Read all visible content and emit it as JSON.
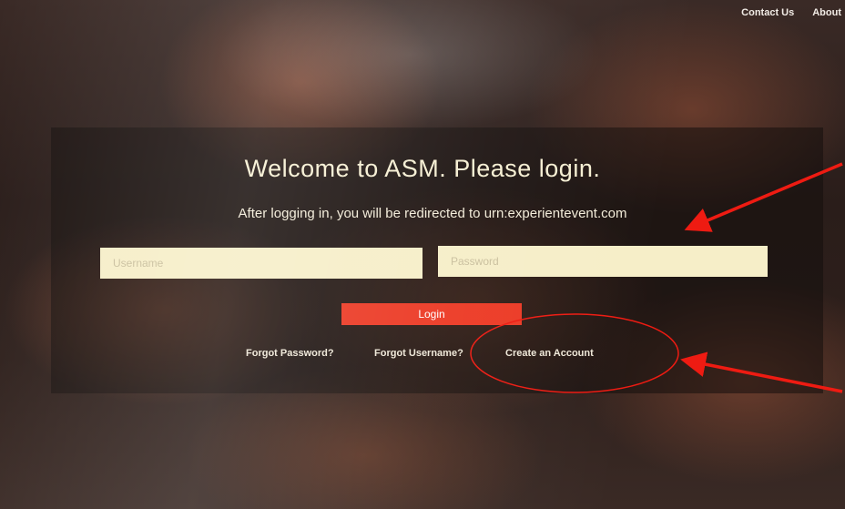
{
  "nav": {
    "contact_label": "Contact Us",
    "about_label": "About"
  },
  "login": {
    "title": "Welcome to ASM. Please login.",
    "redirect_text": "After logging in, you will be redirected to urn:experientevent.com",
    "username_placeholder": "Username",
    "password_placeholder": "Password",
    "login_label": "Login",
    "forgot_password_label": "Forgot Password?",
    "forgot_username_label": "Forgot Username?",
    "create_account_label": "Create an Account"
  },
  "colors": {
    "login_button": "#ec3a25",
    "field_background": "#f6eec8",
    "annotation": "#ee1b12"
  },
  "annotation_icons": [
    "red-arrow-icon",
    "red-circle-icon"
  ]
}
